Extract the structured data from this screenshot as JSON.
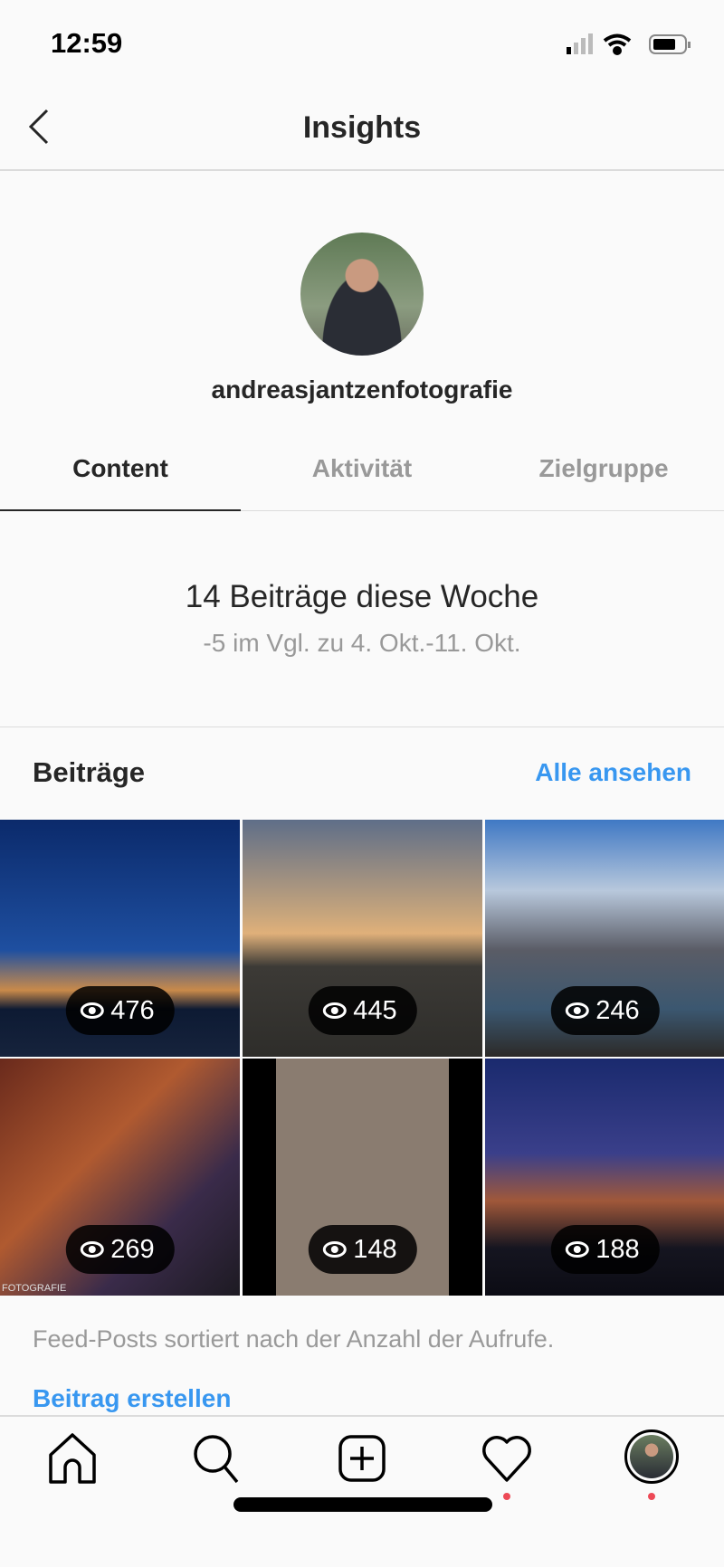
{
  "status": {
    "time": "12:59"
  },
  "header": {
    "title": "Insights"
  },
  "profile": {
    "username": "andreasjantzenfotografie"
  },
  "tabs": [
    {
      "label": "Content",
      "active": true
    },
    {
      "label": "Aktivität",
      "active": false
    },
    {
      "label": "Zielgruppe",
      "active": false
    }
  ],
  "summary": {
    "headline": "14 Beiträge diese Woche",
    "comparison": "-5 im Vgl. zu 4. Okt.-11. Okt."
  },
  "posts": {
    "title": "Beiträge",
    "see_all": "Alle ansehen",
    "items": [
      {
        "views": "476"
      },
      {
        "views": "445"
      },
      {
        "views": "246"
      },
      {
        "views": "269"
      },
      {
        "views": "148"
      },
      {
        "views": "188"
      }
    ],
    "caption": "Feed-Posts sortiert nach der Anzahl der Aufrufe.",
    "create": "Beitrag erstellen"
  },
  "watermark": "FOTOGRAFIE",
  "colors": {
    "accent": "#3897f0",
    "notification": "#ed4956"
  },
  "tabbar": [
    "home-icon",
    "search-icon",
    "add-icon",
    "heart-icon",
    "profile-avatar"
  ]
}
